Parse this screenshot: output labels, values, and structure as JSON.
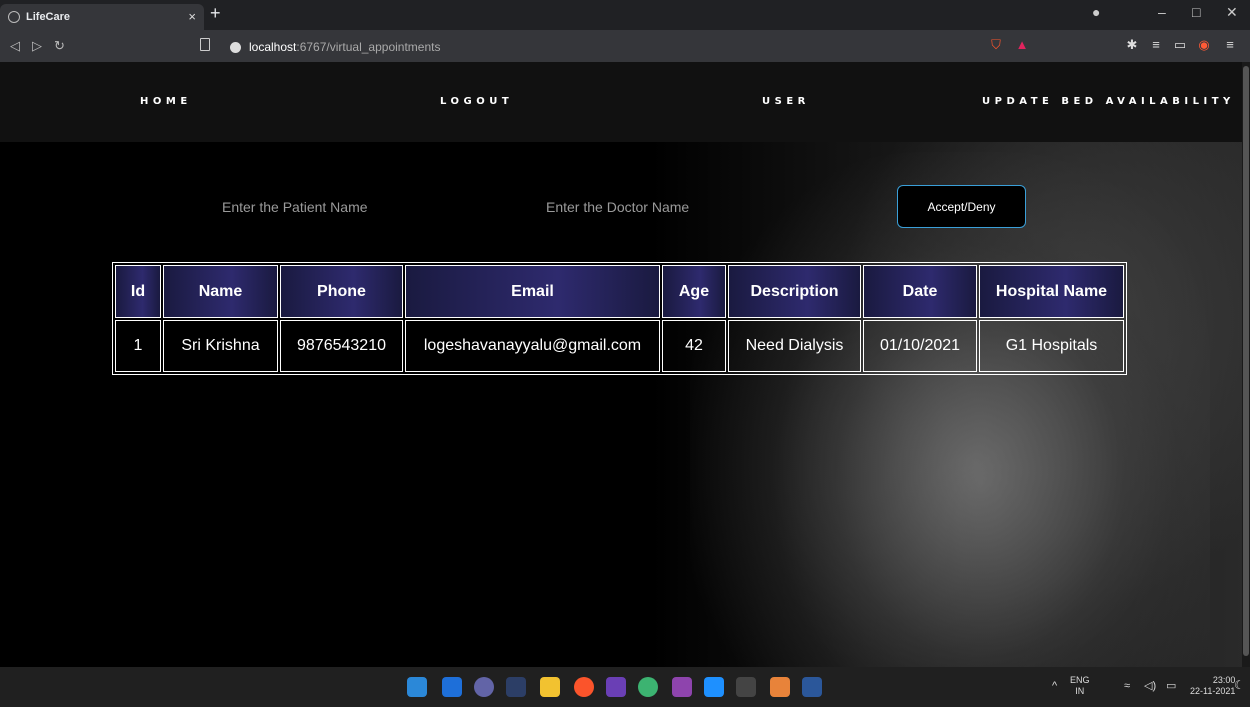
{
  "browser": {
    "tab_title": "LifeCare",
    "tab_close": "×",
    "new_tab": "+",
    "url_host": "localhost",
    "url_path": ":6767/virtual_appointments"
  },
  "nav": {
    "home": "HOME",
    "logout": "LOGOUT",
    "user": "USER",
    "update_bed": "UPDATE BED AVAILABILITY"
  },
  "search": {
    "patient_placeholder": "Enter the Patient Name",
    "doctor_placeholder": "Enter the Doctor Name",
    "accept_label": "Accept/Deny"
  },
  "table": {
    "headers": [
      "Id",
      "Name",
      "Phone",
      "Email",
      "Age",
      "Description",
      "Date",
      "Hospital Name"
    ],
    "rows": [
      [
        "1",
        "Sri Krishna",
        "9876543210",
        "logeshavanayyalu@gmail.com",
        "42",
        "Need Dialysis",
        "01/10/2021",
        "G1 Hospitals"
      ]
    ]
  },
  "taskbar": {
    "lang_top": "ENG",
    "lang_bottom": "IN",
    "time": "23:00",
    "date": "22-11-2021"
  },
  "colors": {
    "nav_bg": "#111111",
    "header_cell": "#2e2a6e",
    "accept_border": "#3a9fd8"
  }
}
